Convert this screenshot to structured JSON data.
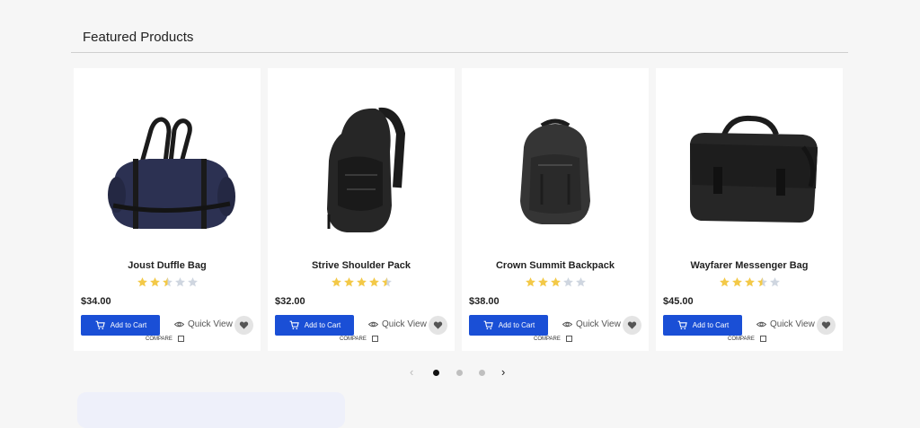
{
  "section": {
    "title": "Featured Products"
  },
  "products": [
    {
      "name": "Joust Duffle Bag",
      "price": "$34.00",
      "rating": 2.5,
      "add_label": "Add to Cart",
      "quick_label": "Quick View",
      "compare_label": "COMPARE",
      "icon": "duffle-bag"
    },
    {
      "name": "Strive Shoulder Pack",
      "price": "$32.00",
      "rating": 4.5,
      "add_label": "Add to Cart",
      "quick_label": "Quick View",
      "compare_label": "COMPARE",
      "icon": "sling-backpack"
    },
    {
      "name": "Crown Summit Backpack",
      "price": "$38.00",
      "rating": 3,
      "add_label": "Add to Cart",
      "quick_label": "Quick View",
      "compare_label": "COMPARE",
      "icon": "backpack"
    },
    {
      "name": "Wayfarer Messenger Bag",
      "price": "$45.00",
      "rating": 3.5,
      "add_label": "Add to Cart",
      "quick_label": "Quick View",
      "compare_label": "COMPARE",
      "icon": "messenger-bag"
    }
  ],
  "pager": {
    "prev": "‹",
    "next": "›",
    "pages": 3,
    "active": 0
  },
  "colors": {
    "accent": "#1a4fd6",
    "star_on": "#f3c948",
    "star_off": "#cfd6e0"
  }
}
